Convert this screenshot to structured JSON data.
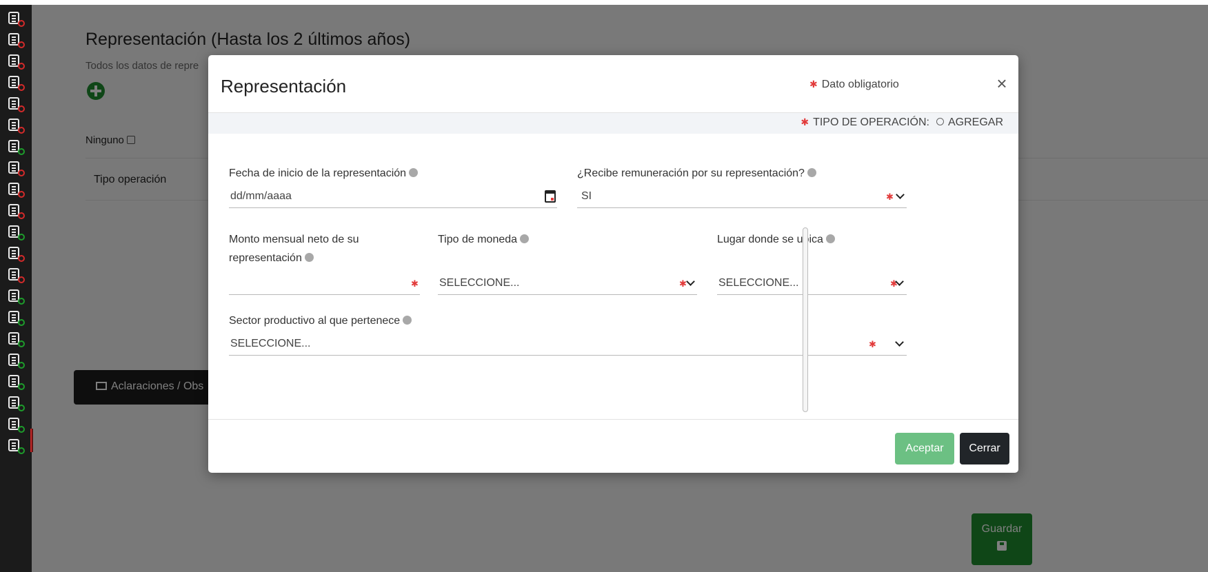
{
  "background": {
    "title": "Representación (Hasta los 2 últimos años)",
    "subtitle": "Todos los datos de repre",
    "ninguno_label": "Ninguno",
    "table_header_tipo": "Tipo operación",
    "aclaraciones_label": "Aclaraciones / Obs",
    "guardar_label": "Guardar"
  },
  "sidebar": {
    "icons": [
      {
        "name": "declarant-data-icon",
        "status": "red"
      },
      {
        "name": "address-icon",
        "status": "red"
      },
      {
        "name": "curriculum-icon",
        "status": "red"
      },
      {
        "name": "employment-icon",
        "status": "red"
      },
      {
        "name": "experience-icon",
        "status": "red"
      },
      {
        "name": "partner-icon",
        "status": "red"
      },
      {
        "name": "dependents-icon",
        "status": "green"
      },
      {
        "name": "income-icon",
        "status": "red"
      },
      {
        "name": "property-icon",
        "status": "red"
      },
      {
        "name": "vehicle-icon",
        "status": "red"
      },
      {
        "name": "investments-icon",
        "status": "green"
      },
      {
        "name": "assets-icon",
        "status": "red"
      },
      {
        "name": "debts-icon",
        "status": "red"
      },
      {
        "name": "loans-icon",
        "status": "green"
      },
      {
        "name": "participation-icon",
        "status": "green"
      },
      {
        "name": "decisions-icon",
        "status": "green"
      },
      {
        "name": "support-icon",
        "status": "green"
      },
      {
        "name": "representation-icon",
        "status": "green"
      },
      {
        "name": "clients-icon",
        "status": "green"
      },
      {
        "name": "benefits-icon",
        "status": "green"
      },
      {
        "name": "trust-icon",
        "status": "green"
      }
    ],
    "colors": {
      "red": "#d42a2a",
      "green": "#1d9d2b"
    }
  },
  "modal": {
    "title": "Representación",
    "required_legend": "Dato obligatorio",
    "close_symbol": "×",
    "operation_type_label": "TIPO DE OPERACIÓN:",
    "operation_option": "AGREGAR",
    "fields": {
      "fecha_inicio": {
        "label": "Fecha de inicio de la representación",
        "placeholder": "dd/mm/aaaa"
      },
      "recibe_remuneracion": {
        "label": "¿Recibe remuneración por su representación?",
        "value": "SI"
      },
      "monto_mensual": {
        "label": "Monto mensual neto de su representación",
        "value": ""
      },
      "tipo_moneda": {
        "label": "Tipo de moneda",
        "value": "SELECCIONE..."
      },
      "lugar_ubica": {
        "label": "Lugar donde se ubica",
        "value": "SELECCIONE..."
      },
      "sector_productivo": {
        "label": "Sector productivo al que pertenece",
        "value": "SELECCIONE..."
      }
    },
    "buttons": {
      "aceptar": "Aceptar",
      "cerrar": "Cerrar"
    }
  },
  "colors": {
    "accent_green": "#1f8d2f",
    "accept_green": "#6cc083",
    "dark_button": "#212529",
    "required_red": "#e23b3b"
  }
}
